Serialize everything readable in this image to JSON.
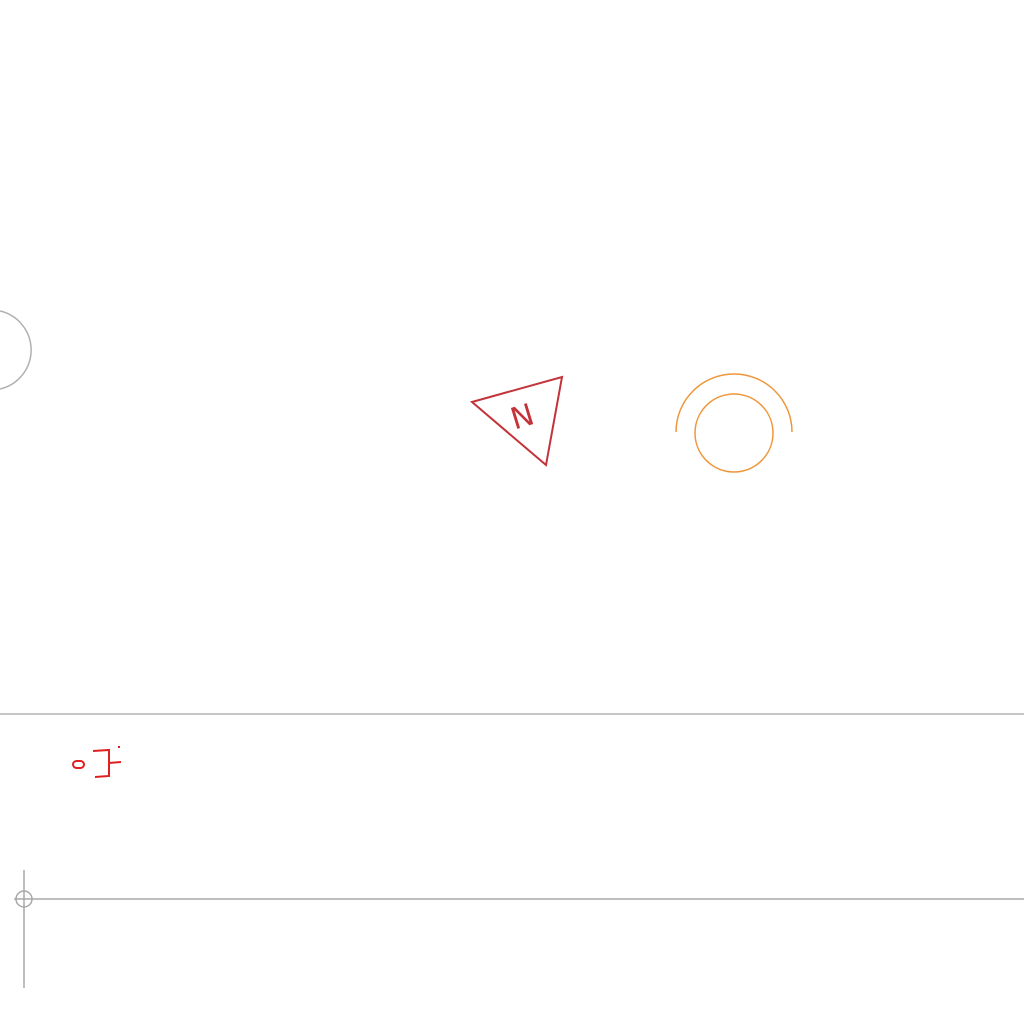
{
  "drawing": {
    "north_arrow": {
      "letter": "N",
      "color": "#c3333a"
    },
    "arc_symbol": {
      "color": "#f0963a"
    },
    "partial_circle": {
      "color": "#b0b0b0"
    },
    "separator_line": {
      "color": "#b4b4b4"
    },
    "crosshair": {
      "color": "#a8a8a8"
    },
    "small_symbol": {
      "color": "#e02020"
    }
  }
}
